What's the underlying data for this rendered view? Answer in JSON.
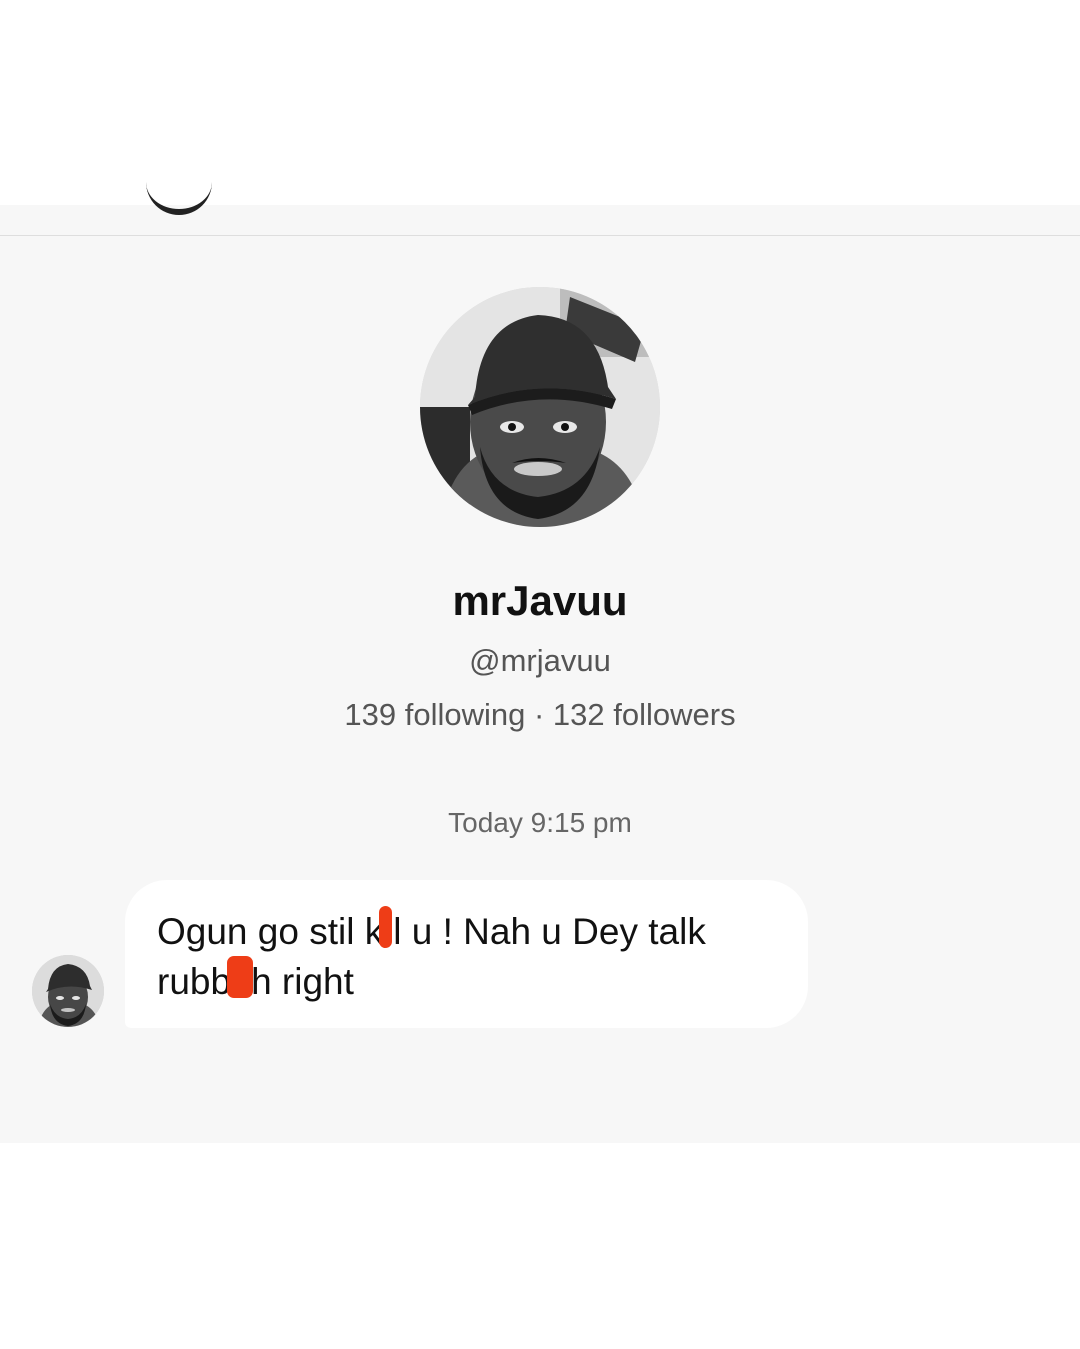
{
  "profile": {
    "name": "mrJavuu",
    "handle": "@mrjavuu",
    "stats": "139 following · 132 followers"
  },
  "conversation": {
    "timestamp": "Today 9:15 pm",
    "message": {
      "line1_part1": "Ogun go stil k",
      "line1_part2": "l u ! Nah u Dey talk",
      "line2_part1": "rubb",
      "line2_part2": "h right"
    }
  },
  "colors": {
    "screen_background": "#f7f7f7",
    "bubble_background": "#ffffff",
    "redaction_mark": "#ee3d17"
  },
  "icons": {
    "profile_avatar": "user-photo-avatar",
    "message_avatar": "user-photo-avatar"
  }
}
